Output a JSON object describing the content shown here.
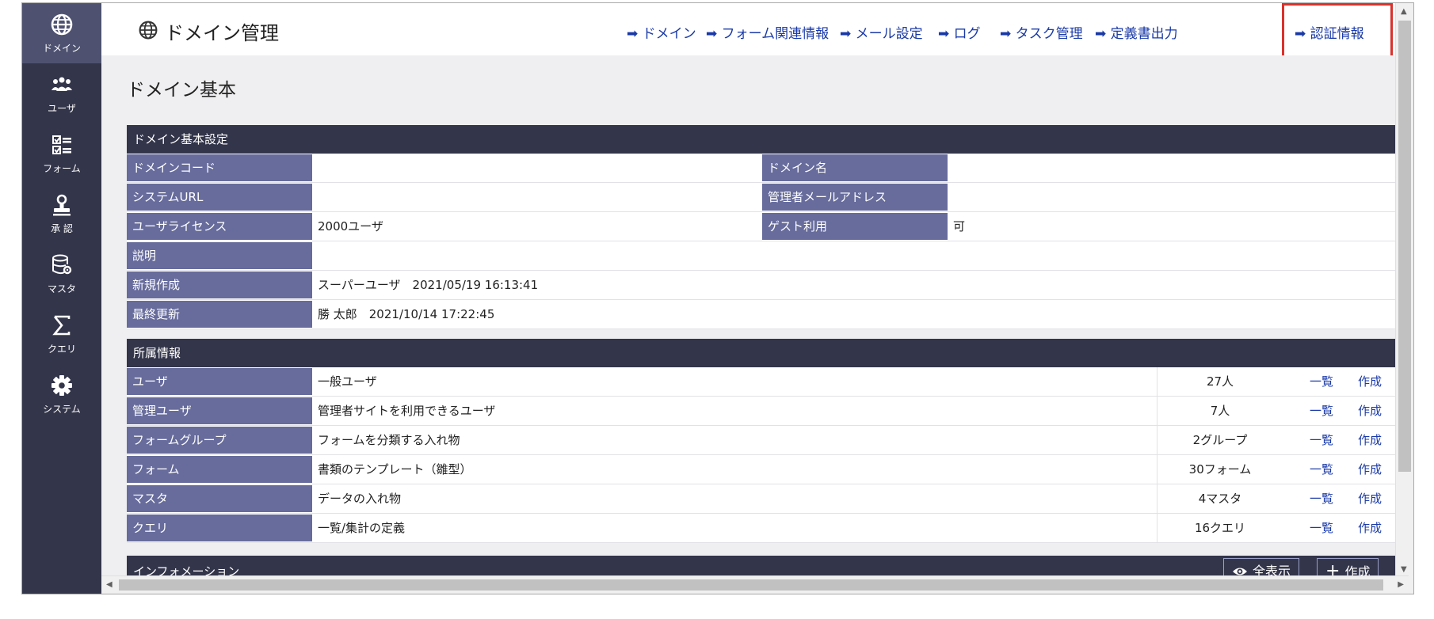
{
  "sidebar": {
    "items": [
      {
        "label": "ドメイン",
        "icon": "globe-icon",
        "active": true
      },
      {
        "label": "ユーザ",
        "icon": "users-icon"
      },
      {
        "label": "フォーム",
        "icon": "checklist-icon"
      },
      {
        "label": "承 認",
        "icon": "stamp-icon"
      },
      {
        "label": "マスタ",
        "icon": "database-icon"
      },
      {
        "label": "クエリ",
        "icon": "sigma-icon"
      },
      {
        "label": "システム",
        "icon": "gear-icon"
      }
    ]
  },
  "header": {
    "title": "ドメイン管理",
    "nav": [
      "➡ ドメイン",
      "➡ フォーム関連情報",
      "➡ メール設定",
      "➡ ログ",
      "➡ タスク管理",
      "➡ 定義書出力",
      "➡ 認証情報"
    ]
  },
  "page": {
    "title": "ドメイン基本"
  },
  "basic": {
    "heading": "ドメイン基本設定",
    "rows": [
      {
        "label": "ドメインコード",
        "value": "",
        "label2": "ドメイン名",
        "value2": ""
      },
      {
        "label": "システムURL",
        "value": "",
        "label2": "管理者メールアドレス",
        "value2": ""
      },
      {
        "label": "ユーザライセンス",
        "value": "2000ユーザ",
        "label2": "ゲスト利用",
        "value2": "可"
      }
    ],
    "description_label": "説明",
    "description_value": "",
    "created_label": "新規作成",
    "created_value": "スーパーユーザ　2021/05/19 16:13:41",
    "updated_label": "最終更新",
    "updated_value": "勝 太郎　2021/10/14 17:22:45"
  },
  "affiliation": {
    "heading": "所属情報",
    "list_label": "一覧",
    "create_label": "作成",
    "rows": [
      {
        "label": "ユーザ",
        "desc": "一般ユーザ",
        "count": "27人"
      },
      {
        "label": "管理ユーザ",
        "desc": "管理者サイトを利用できるユーザ",
        "count": "7人"
      },
      {
        "label": "フォームグループ",
        "desc": "フォームを分類する入れ物",
        "count": "2グループ"
      },
      {
        "label": "フォーム",
        "desc": "書類のテンプレート（雛型）",
        "count": "30フォーム"
      },
      {
        "label": "マスタ",
        "desc": "データの入れ物",
        "count": "4マスタ"
      },
      {
        "label": "クエリ",
        "desc": "一覧/集計の定義",
        "count": "16クエリ"
      }
    ]
  },
  "information": {
    "heading": "インフォメーション",
    "show_all_label": "全表示",
    "create_label": "作成"
  },
  "colors": {
    "sidebar_bg": "#33354a",
    "label_bg": "#676c9c",
    "link": "#1a3aa8",
    "highlight": "#d9322c"
  }
}
